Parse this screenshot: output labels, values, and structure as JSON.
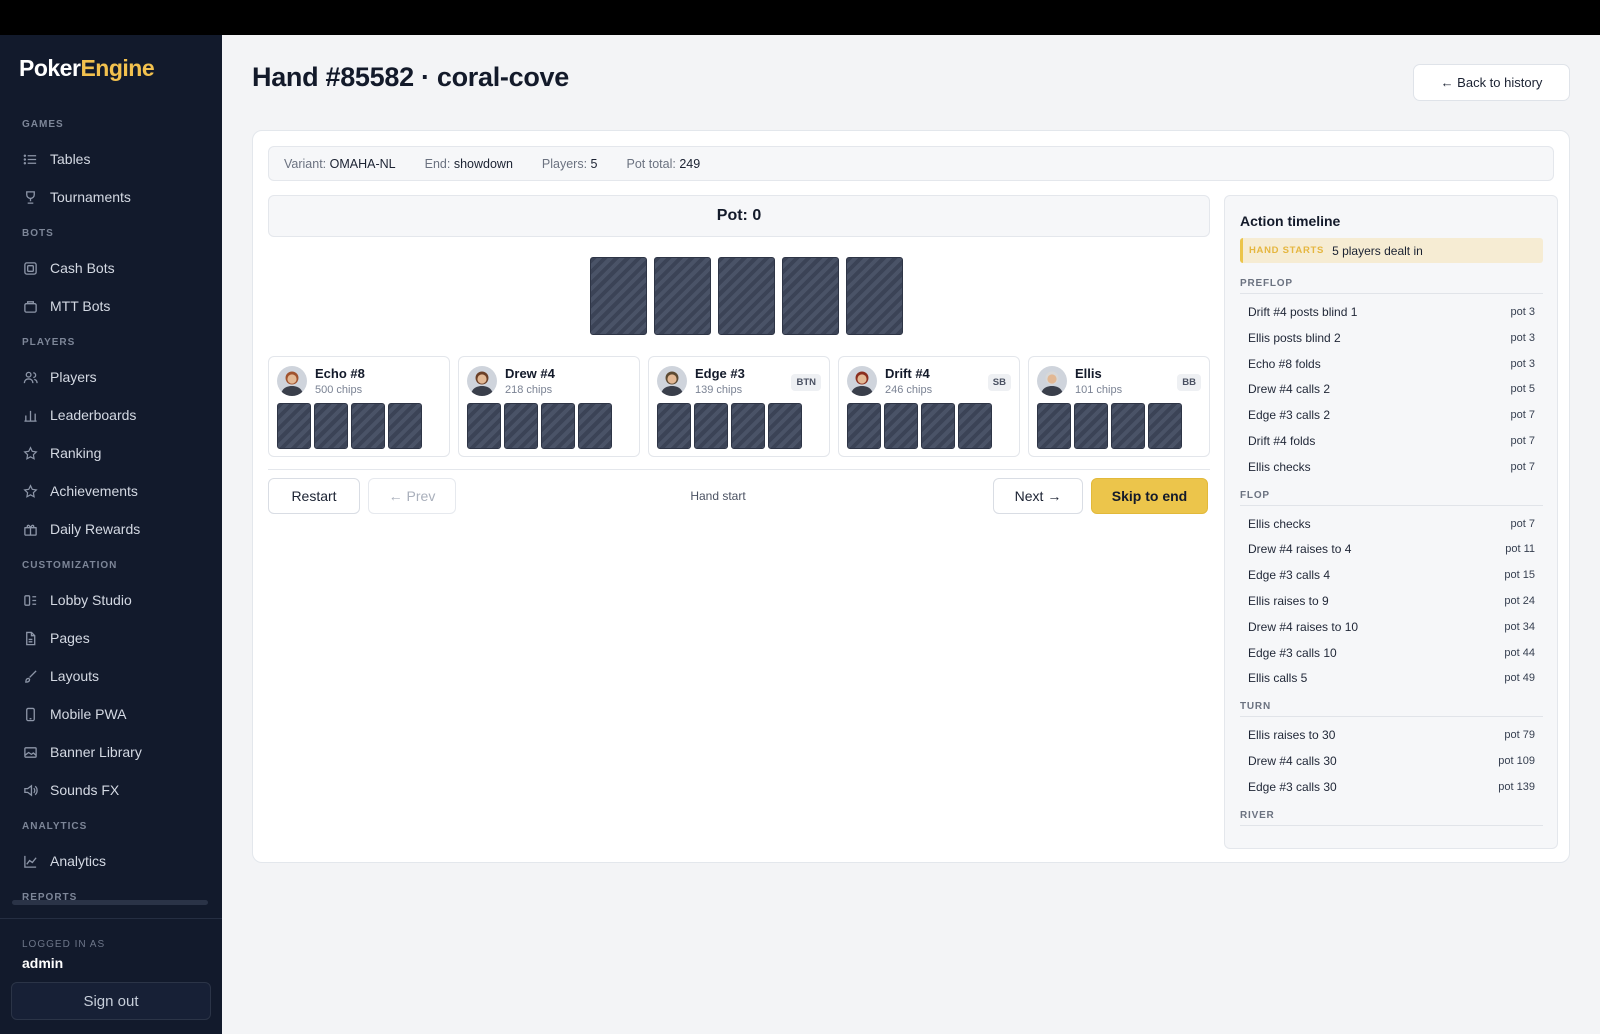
{
  "app": {
    "logo_main": "Poker",
    "logo_accent": "Engine"
  },
  "sidebar": {
    "sections": [
      {
        "label": "GAMES",
        "items": [
          {
            "label": "Tables",
            "icon": "list-icon"
          },
          {
            "label": "Tournaments",
            "icon": "trophy-icon"
          }
        ]
      },
      {
        "label": "BOTS",
        "items": [
          {
            "label": "Cash Bots",
            "icon": "chip-icon"
          },
          {
            "label": "MTT Bots",
            "icon": "briefcase-icon"
          }
        ]
      },
      {
        "label": "PLAYERS",
        "items": [
          {
            "label": "Players",
            "icon": "users-icon"
          },
          {
            "label": "Leaderboards",
            "icon": "bar-chart-icon"
          },
          {
            "label": "Ranking",
            "icon": "star-icon"
          },
          {
            "label": "Achievements",
            "icon": "star-icon"
          },
          {
            "label": "Daily Rewards",
            "icon": "gift-icon"
          }
        ]
      },
      {
        "label": "CUSTOMIZATION",
        "items": [
          {
            "label": "Lobby Studio",
            "icon": "layout-icon"
          },
          {
            "label": "Pages",
            "icon": "file-icon"
          },
          {
            "label": "Layouts",
            "icon": "brush-icon"
          },
          {
            "label": "Mobile PWA",
            "icon": "phone-icon"
          },
          {
            "label": "Banner Library",
            "icon": "image-icon"
          },
          {
            "label": "Sounds FX",
            "icon": "speaker-icon"
          }
        ]
      },
      {
        "label": "ANALYTICS",
        "items": [
          {
            "label": "Analytics",
            "icon": "line-chart-icon"
          }
        ]
      },
      {
        "label": "REPORTS",
        "items": []
      }
    ],
    "logged_in_label": "LOGGED IN AS",
    "logged_in_user": "admin",
    "sign_out": "Sign out"
  },
  "page": {
    "title": "Hand #85582 · coral-cove",
    "back_button": "← Back to history"
  },
  "meta": {
    "variant_label": "Variant:",
    "variant_value": "OMAHA-NL",
    "end_label": "End:",
    "end_value": "showdown",
    "players_label": "Players:",
    "players_value": "5",
    "pot_total_label": "Pot total:",
    "pot_total_value": "249"
  },
  "table": {
    "pot": "Pot: 0",
    "board_cards": 5,
    "players": [
      {
        "name": "Echo #8",
        "chips": "500 chips",
        "badge": "",
        "hole_cards": 4,
        "avatar_color": "#a0522d"
      },
      {
        "name": "Drew #4",
        "chips": "218 chips",
        "badge": "",
        "hole_cards": 4,
        "avatar_color": "#6b3f26"
      },
      {
        "name": "Edge #3",
        "chips": "139 chips",
        "badge": "BTN",
        "hole_cards": 4,
        "avatar_color": "#5c4a32"
      },
      {
        "name": "Drift #4",
        "chips": "246 chips",
        "badge": "SB",
        "hole_cards": 4,
        "avatar_color": "#8b2e1e"
      },
      {
        "name": "Ellis",
        "chips": "101 chips",
        "badge": "BB",
        "hole_cards": 4,
        "avatar_color": "#d8d8d8"
      }
    ]
  },
  "controls": {
    "restart": "Restart",
    "prev": "← Prev",
    "step": "Hand start",
    "next": "Next →",
    "skip": "Skip to end"
  },
  "timeline": {
    "title": "Action timeline",
    "start_tag": "HAND STARTS",
    "start_text": "5 players dealt in",
    "streets": [
      {
        "label": "PREFLOP",
        "actions": [
          {
            "text": "Drift #4 posts blind 1",
            "pot": "pot 3"
          },
          {
            "text": "Ellis posts blind 2",
            "pot": "pot 3"
          },
          {
            "text": "Echo #8 folds",
            "pot": "pot 3"
          },
          {
            "text": "Drew #4 calls 2",
            "pot": "pot 5"
          },
          {
            "text": "Edge #3 calls 2",
            "pot": "pot 7"
          },
          {
            "text": "Drift #4 folds",
            "pot": "pot 7"
          },
          {
            "text": "Ellis checks",
            "pot": "pot 7"
          }
        ]
      },
      {
        "label": "FLOP",
        "actions": [
          {
            "text": "Ellis checks",
            "pot": "pot 7"
          },
          {
            "text": "Drew #4 raises to 4",
            "pot": "pot 11"
          },
          {
            "text": "Edge #3 calls 4",
            "pot": "pot 15"
          },
          {
            "text": "Ellis raises to 9",
            "pot": "pot 24"
          },
          {
            "text": "Drew #4 raises to 10",
            "pot": "pot 34"
          },
          {
            "text": "Edge #3 calls 10",
            "pot": "pot 44"
          },
          {
            "text": "Ellis calls 5",
            "pot": "pot 49"
          }
        ]
      },
      {
        "label": "TURN",
        "actions": [
          {
            "text": "Ellis raises to 30",
            "pot": "pot 79"
          },
          {
            "text": "Drew #4 calls 30",
            "pot": "pot 109"
          },
          {
            "text": "Edge #3 calls 30",
            "pot": "pot 139"
          }
        ]
      },
      {
        "label": "RIVER",
        "actions": []
      }
    ]
  }
}
